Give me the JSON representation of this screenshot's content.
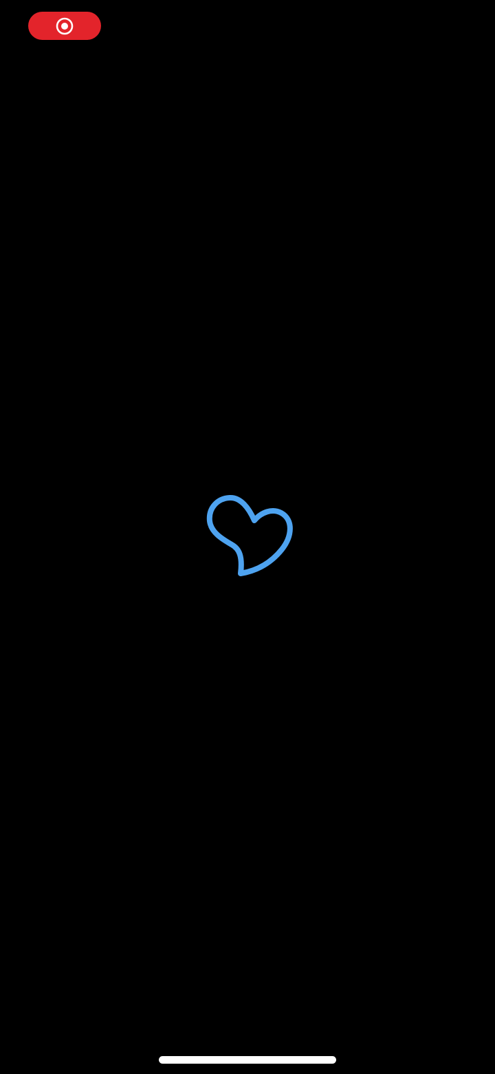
{
  "status_bar": {
    "recording_indicator": {
      "icon": "record-icon",
      "color": "#E3242B"
    }
  },
  "splash": {
    "logo_icon": "heart-outline-icon",
    "logo_color": "#4EA3F0"
  },
  "home_indicator": {
    "color": "#FFFFFF"
  },
  "background_color": "#000000"
}
